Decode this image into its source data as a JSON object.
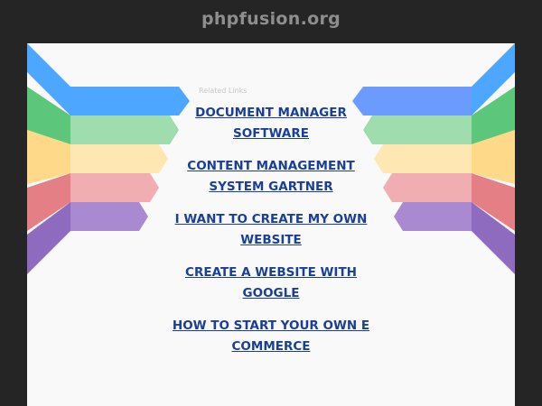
{
  "header": {
    "title": "phpfusion.org"
  },
  "related": {
    "label": "Related Links",
    "links": [
      "DOCUMENT MANAGER SOFTWARE",
      "CONTENT MANAGEMENT SYSTEM GARTNER",
      "I WANT TO CREATE MY OWN WEBSITE",
      "CREATE A WEBSITE WITH GOOGLE",
      "HOW TO START YOUR OWN E COMMERCE"
    ]
  },
  "colors": {
    "page_background": "#252525",
    "panel_background": "#f9f9f9",
    "link": "#1a3f9a",
    "ribbons": [
      "#4da6ff",
      "#5cc77a",
      "#ffd98a",
      "#e57f86",
      "#8e6bbf"
    ]
  }
}
